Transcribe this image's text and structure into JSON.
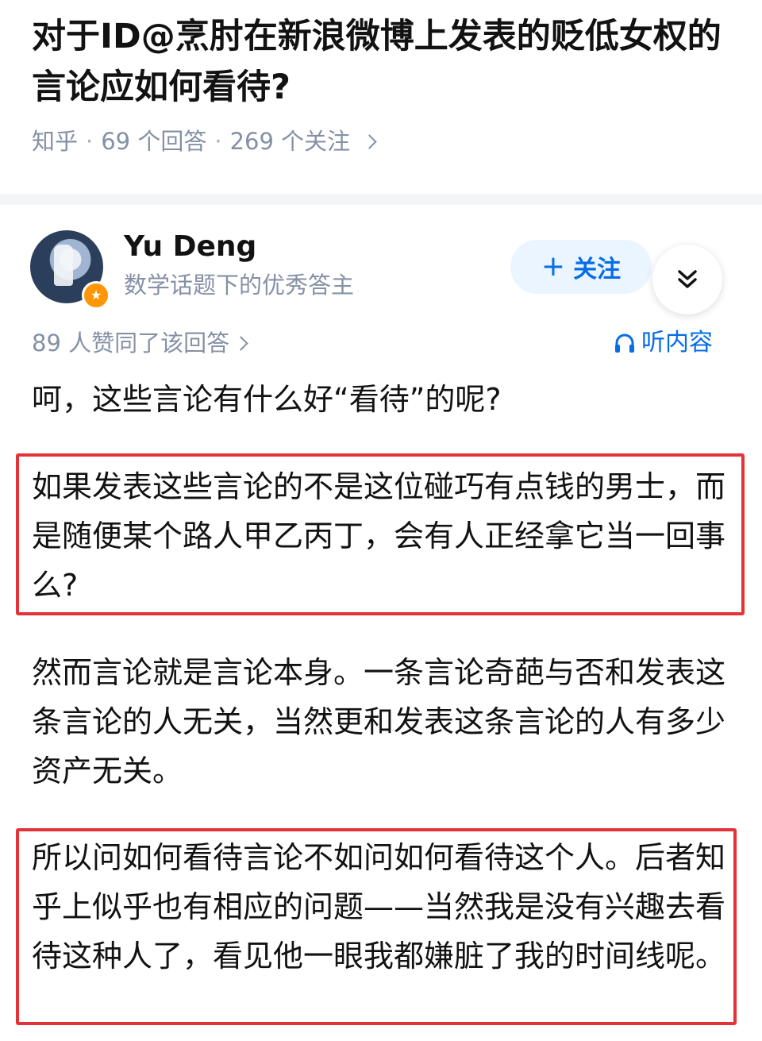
{
  "question": {
    "title": "对于ID@烹肘在新浪微博上发表的贬低女权的言论应如何看待?",
    "meta": {
      "site": "知乎",
      "answers": "69 个回答",
      "followers": "269 个关注"
    }
  },
  "answer": {
    "author": {
      "name": "Yu Deng",
      "description": "数学话题下的优秀答主"
    },
    "follow_label": "关注",
    "likes_text": "89 人赞同了该回答",
    "listen_label": "听内容",
    "paragraphs": [
      "呵，这些言论有什么好“看待”的呢?",
      "如果发表这些言论的不是这位碰巧有点钱的男士，而是随便某个路人甲乙丙丁，会有人正经拿它当一回事么?",
      "然而言论就是言论本身。一条言论奇葩与否和发表这条言论的人无关，当然更和发表这条言论的人有多少资产无关。",
      "所以问如何看待言论不如问如何看待这个人。后者知乎上似乎也有相应的问题——当然我是没有兴趣去看待这种人了，看见他一眼我都嫌脏了我的时间线呢。"
    ]
  },
  "colors": {
    "accent": "#056de8",
    "muted": "#8590a6",
    "highlight_border": "#e53238",
    "badge": "#ff9607"
  },
  "icons": [
    "chevron-right-icon",
    "plus-icon",
    "double-chevron-down-icon",
    "headphones-icon",
    "badge-star-icon"
  ]
}
